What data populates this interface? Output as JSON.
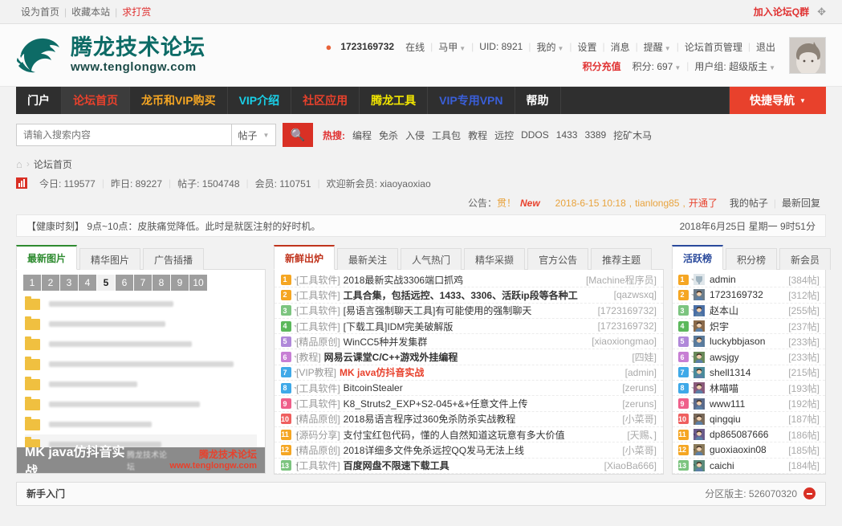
{
  "topbar": {
    "links": [
      "设为首页",
      "收藏本站",
      "求打赏"
    ],
    "join_qq": "加入论坛Q群",
    "expand_icon": "expand-icon"
  },
  "header": {
    "logo_title": "腾龙技术论坛",
    "logo_url": "www.tenglongw.com",
    "user": {
      "qq_icon": "qq-penguin-icon",
      "uid_number": "1723169732",
      "online_status": "在线",
      "vest": "马甲",
      "uid_label": "UID: 8921",
      "mine": "我的",
      "settings": "设置",
      "messages": "消息",
      "notices": "提醒",
      "forum_admin": "论坛首页管理",
      "logout": "退出",
      "recharge": "积分充值",
      "points": "积分: 697",
      "group": "用户组: 超级版主"
    }
  },
  "nav": {
    "items": [
      {
        "label": "门户",
        "color": "#ffffff",
        "active": false
      },
      {
        "label": "论坛首页",
        "color": "#e8412c",
        "active": true
      },
      {
        "label": "龙币和VIP购买",
        "color": "#f5a623",
        "active": false
      },
      {
        "label": "VIP介绍",
        "color": "#19d0e8",
        "active": false
      },
      {
        "label": "社区应用",
        "color": "#e8412c",
        "active": false
      },
      {
        "label": "腾龙工具",
        "color": "#f2e600",
        "active": false
      },
      {
        "label": "VIP专用VPN",
        "color": "#3a5fd9",
        "active": false
      },
      {
        "label": "帮助",
        "color": "#ffffff",
        "active": false
      }
    ],
    "quicknav": "快捷导航"
  },
  "search": {
    "placeholder": "请输入搜索内容",
    "value": "",
    "scope": "帖子",
    "search_icon": "search-icon",
    "hot_label": "热搜:",
    "hot_terms": [
      "编程",
      "免杀",
      "入侵",
      "工具包",
      "教程",
      "远控",
      "DDOS",
      "1433",
      "3389",
      "挖矿木马"
    ]
  },
  "breadcrumb": {
    "home_icon": "home-icon",
    "current": "论坛首页"
  },
  "stats": {
    "today": "今日: 119577",
    "yesterday": "昨日: 89227",
    "posts": "帖子: 1504748",
    "members": "会员: 110751",
    "welcome": "欢迎新会员: xiaoyaoxiao"
  },
  "announce": {
    "label": "公告：",
    "text": "贯！",
    "new_tag": "New",
    "date": "2018-6-15 10:18",
    "author": "tianlong85",
    "opened": "开通了",
    "my_posts": "我的帖子",
    "latest_reply": "最新回复"
  },
  "health": {
    "text": "【健康时刻】 9点~10点：皮肤痛觉降低。此时是就医注射的好时机。",
    "datetime": "2018年6月25日 星期一 9时51分"
  },
  "left_panel": {
    "tabs": [
      {
        "label": "最新图片",
        "active": true
      },
      {
        "label": "精华图片",
        "active": false
      },
      {
        "label": "广告插播",
        "active": false
      }
    ],
    "pager": [
      "1",
      "2",
      "3",
      "4",
      "5",
      "6",
      "7",
      "8",
      "9",
      "10"
    ],
    "current_page": "5",
    "caption_title": "MK java仿抖音实战",
    "caption_sub": "腾龙技术论坛",
    "brand_line1": "腾龙技术论坛",
    "brand_line2": "www.tenglongw.com"
  },
  "mid_panel": {
    "tabs": [
      {
        "label": "新鲜出炉",
        "active": true
      },
      {
        "label": "最新关注",
        "active": false
      },
      {
        "label": "人气热门",
        "active": false
      },
      {
        "label": "精华采撷",
        "active": false
      },
      {
        "label": "官方公告",
        "active": false
      },
      {
        "label": "推荐主题",
        "active": false
      }
    ],
    "threads": [
      {
        "rank": "1",
        "color": "#f5a623",
        "category": "[工具软件]",
        "title": "2018最新实战3306端口抓鸡",
        "bold": false,
        "highlight": false,
        "author": "[Machine程序员]"
      },
      {
        "rank": "2",
        "color": "#f5a623",
        "category": "[工具软件]",
        "title": "工具合集，包括远控、1433、3306、活跃ip段等各种工",
        "bold": true,
        "highlight": false,
        "author": "[qazwsxq]"
      },
      {
        "rank": "3",
        "color": "#7cc47f",
        "category": "[工具软件]",
        "title": "[易语言强制聊天工具]有可能使用的强制聊天",
        "bold": false,
        "highlight": false,
        "author": "[1723169732]"
      },
      {
        "rank": "4",
        "color": "#5cb85c",
        "category": "[工具软件]",
        "title": "[下载工具]IDM完美破解版",
        "bold": false,
        "highlight": false,
        "author": "[1723169732]"
      },
      {
        "rank": "5",
        "color": "#b088d9",
        "category": "[精品原创]",
        "title": "WinCC5种并发集群",
        "bold": false,
        "highlight": false,
        "author": "[xiaoxiongmao]"
      },
      {
        "rank": "6",
        "color": "#c77fd4",
        "category": "[教程]",
        "title": "网易云课堂C/C++游戏外挂编程",
        "bold": true,
        "highlight": false,
        "author": "[四娃]"
      },
      {
        "rank": "7",
        "color": "#3fa9e8",
        "category": "[VIP教程]",
        "title": "MK java仿抖音实战",
        "bold": false,
        "highlight": true,
        "author": "[admin]"
      },
      {
        "rank": "8",
        "color": "#3fa9e8",
        "category": "[工具软件]",
        "title": "BitcoinStealer",
        "bold": false,
        "highlight": false,
        "author": "[zeruns]"
      },
      {
        "rank": "9",
        "color": "#ef5f8a",
        "category": "[工具软件]",
        "title": "K8_Struts2_EXP+S2-045+&+任意文件上传",
        "bold": false,
        "highlight": false,
        "author": "[zeruns]"
      },
      {
        "rank": "10",
        "color": "#ef5f5f",
        "category": "[精品原创]",
        "title": "2018易语言程序过360免杀防杀实战教程",
        "bold": false,
        "highlight": false,
        "author": "[小菜哥]"
      },
      {
        "rank": "11",
        "color": "#f5a623",
        "category": "[源码分享]",
        "title": "支付宝红包代码，懂的人自然知道这玩意有多大价值",
        "bold": false,
        "highlight": false,
        "author": "[天赐、]"
      },
      {
        "rank": "12",
        "color": "#f5a623",
        "category": "[精品原创]",
        "title": "2018详细多文件免杀远控QQ发马无法上线",
        "bold": false,
        "highlight": false,
        "author": "[小菜哥]"
      },
      {
        "rank": "13",
        "color": "#7cc47f",
        "category": "[工具软件]",
        "title": "百度网盘不限速下载工具",
        "bold": true,
        "highlight": false,
        "author": "[XiaoBa666]"
      }
    ]
  },
  "right_panel": {
    "tabs": [
      {
        "label": "活跃榜",
        "active": true
      },
      {
        "label": "积分榜",
        "active": false
      },
      {
        "label": "新会员",
        "active": false
      }
    ],
    "members": [
      {
        "rank": "1",
        "color": "#f5a623",
        "name": "admin",
        "posts": "[384帖]"
      },
      {
        "rank": "2",
        "color": "#f5a623",
        "name": "1723169732",
        "posts": "[312帖]"
      },
      {
        "rank": "3",
        "color": "#7cc47f",
        "name": "赵本山",
        "posts": "[255帖]"
      },
      {
        "rank": "4",
        "color": "#5cb85c",
        "name": "炽宇",
        "posts": "[237帖]"
      },
      {
        "rank": "5",
        "color": "#b088d9",
        "name": "luckybbjason",
        "posts": "[233帖]"
      },
      {
        "rank": "6",
        "color": "#c77fd4",
        "name": "awsjgy",
        "posts": "[233帖]"
      },
      {
        "rank": "7",
        "color": "#3fa9e8",
        "name": "shell1314",
        "posts": "[215帖]"
      },
      {
        "rank": "8",
        "color": "#3fa9e8",
        "name": "林喵喵",
        "posts": "[193帖]"
      },
      {
        "rank": "9",
        "color": "#ef5f8a",
        "name": "www111",
        "posts": "[192帖]"
      },
      {
        "rank": "10",
        "color": "#ef5f5f",
        "name": "qingqiu",
        "posts": "[187帖]"
      },
      {
        "rank": "11",
        "color": "#f5a623",
        "name": "dp865087666",
        "posts": "[186帖]"
      },
      {
        "rank": "12",
        "color": "#f5a623",
        "name": "guoxiaoxin08",
        "posts": "[185帖]"
      },
      {
        "rank": "13",
        "color": "#7cc47f",
        "name": "caichi",
        "posts": "[184帖]"
      }
    ]
  },
  "bottom": {
    "title": "新手入门",
    "moderator": "分区版主: 526070320",
    "collapse_icon": "collapse-icon"
  }
}
